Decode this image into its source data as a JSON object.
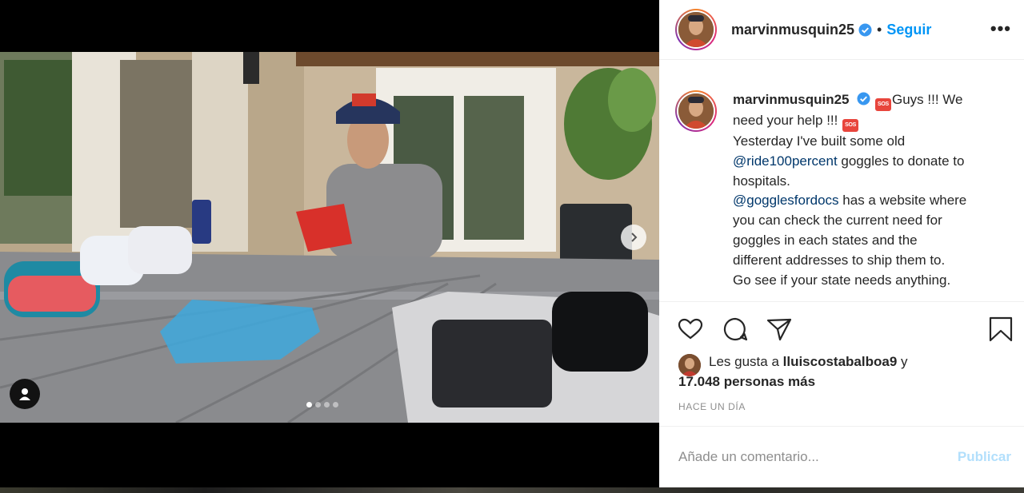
{
  "post": {
    "username": "marvinmusquin25",
    "separator": "•",
    "follow_label": "Seguir",
    "more_label": "•••"
  },
  "caption": {
    "username": "marvinmusquin25",
    "sos_label": "SOS",
    "line1": "Guys !!! We",
    "line2": "need your help !!!",
    "line3": "Yesterday I've built some old",
    "mention1": "@ride100percent",
    "line4_rest": " goggles to donate to",
    "line5": "hospitals.",
    "mention2": "@gogglesfordocs",
    "line6_rest": " has a website where",
    "line7": "you can check the current need for",
    "line8": "goggles in each states and the",
    "line9": "different addresses to ship them to.",
    "line10": "Go see if your state needs anything."
  },
  "likes": {
    "prefix": "Les gusta a ",
    "user": "lluiscostabalboa9",
    "conj": " y",
    "count": "17.048 personas más"
  },
  "time_label": "HACE UN DÍA",
  "comment": {
    "placeholder": "Añade un comentario...",
    "publish_label": "Publicar"
  },
  "carousel": {
    "slides": 4,
    "active_index": 0
  },
  "icons": {
    "like": "heart-icon",
    "comment": "comment-icon",
    "share": "share-icon",
    "save": "bookmark-icon",
    "next": "chevron-right-icon",
    "tag": "user-tag-icon",
    "verified": "verified-badge-icon"
  },
  "colors": {
    "accent": "#0095f6",
    "publish_disabled": "#b2dffc",
    "muted": "#8e8e8e",
    "text": "#262626",
    "mention": "#00376b"
  }
}
